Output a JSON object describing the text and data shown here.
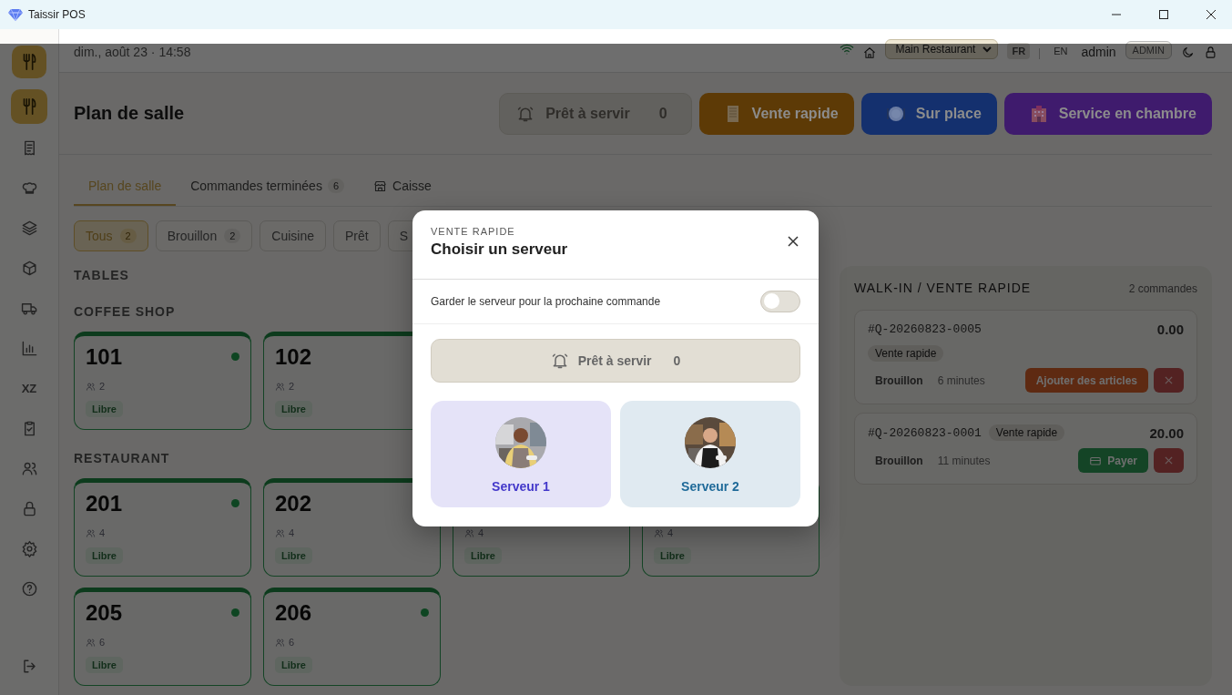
{
  "window": {
    "title": "Taissir POS"
  },
  "sidebar": {
    "items": [
      {
        "kind": "logo"
      },
      {
        "kind": "utensils",
        "selected": true
      },
      {
        "kind": "receipt",
        "selected": false
      },
      {
        "kind": "chef",
        "selected": false
      },
      {
        "kind": "layers",
        "selected": false
      },
      {
        "kind": "box",
        "selected": false
      },
      {
        "kind": "truck",
        "selected": false
      },
      {
        "kind": "chart",
        "selected": false
      },
      {
        "kind": "text",
        "label": "XZ",
        "selected": false
      },
      {
        "kind": "clipboard",
        "selected": false
      },
      {
        "kind": "users",
        "selected": false
      },
      {
        "kind": "lock",
        "selected": false
      },
      {
        "kind": "gear",
        "selected": false
      },
      {
        "kind": "help",
        "selected": false
      },
      {
        "kind": "logout",
        "selected": false
      }
    ]
  },
  "topbar": {
    "date": "dim., août 23 · 14:58",
    "location": "Main Restaurant",
    "languages": [
      {
        "label": "FR",
        "selected": true
      },
      {
        "label": "EN",
        "selected": false
      }
    ],
    "user": "admin",
    "role": "ADMIN"
  },
  "page": {
    "title": "Plan de salle",
    "actions": [
      {
        "kind": "ready",
        "label": "Prêt à servir",
        "count": "0"
      },
      {
        "kind": "quick",
        "label": "Vente rapide",
        "color": "#5d3a06"
      },
      {
        "kind": "dine",
        "label": "Sur place",
        "color": "#14306e"
      },
      {
        "kind": "room",
        "label": "Service en chambre",
        "color": "#3f1b6d"
      }
    ]
  },
  "tabs": [
    {
      "kind": "plain",
      "label": "Plan de salle",
      "selected": true
    },
    {
      "kind": "plain",
      "label": "Commandes terminées",
      "count": "6",
      "selected": false
    },
    {
      "kind": "store",
      "label": "Caisse",
      "selected": false
    }
  ],
  "filters": [
    {
      "label": "Tous",
      "count": "2",
      "selected": true
    },
    {
      "label": "Brouillon",
      "count": "2",
      "selected": false
    },
    {
      "label": "Cuisine",
      "selected": false
    },
    {
      "label": "Prêt",
      "selected": false
    },
    {
      "label": "S",
      "selected": false
    }
  ],
  "tables_heading": "TABLES",
  "sections": [
    {
      "name": "COFFEE SHOP",
      "tables": [
        {
          "number": "101",
          "guests": "2",
          "status": "Libre",
          "dot": true
        },
        {
          "number": "102",
          "guests": "2",
          "status": "Libre"
        }
      ]
    },
    {
      "name": "RESTAURANT",
      "tables": [
        {
          "number": "201",
          "guests": "4",
          "status": "Libre",
          "dot": true
        },
        {
          "number": "202",
          "guests": "4",
          "status": "Libre"
        },
        {
          "guests": "4",
          "status": "Libre"
        },
        {
          "guests": "4",
          "status": "Libre"
        },
        {
          "number": "205",
          "guests": "6",
          "status": "Libre",
          "dot": true
        },
        {
          "number": "206",
          "guests": "6",
          "status": "Libre",
          "dot": true
        }
      ]
    }
  ],
  "walk_in": {
    "title": "WALK-IN / VENTE RAPIDE",
    "count": "2 commandes",
    "orders": [
      {
        "id": "#Q-20260823-0005",
        "tag": "Vente rapide",
        "tag_inline": false,
        "total": "0.00",
        "status": "Brouillon",
        "age": "6 minutes",
        "action": {
          "kind": "add",
          "label": "Ajouter des articles"
        }
      },
      {
        "id": "#Q-20260823-0001",
        "tag": "Vente rapide",
        "tag_inline": true,
        "total": "20.00",
        "status": "Brouillon",
        "age": "11 minutes",
        "action": {
          "kind": "pay",
          "label": "Payer"
        }
      }
    ]
  },
  "modal": {
    "eyebrow": "VENTE RAPIDE",
    "title": "Choisir un serveur",
    "keep_label": "Garder le serveur pour la prochaine commande",
    "keep_server": false,
    "ready": {
      "label": "Prêt à servir",
      "count": "0"
    },
    "servers": [
      {
        "name": "Serveur 1",
        "color": "#4338ca"
      },
      {
        "name": "Serveur 2",
        "color": "#1f6a99"
      }
    ]
  }
}
